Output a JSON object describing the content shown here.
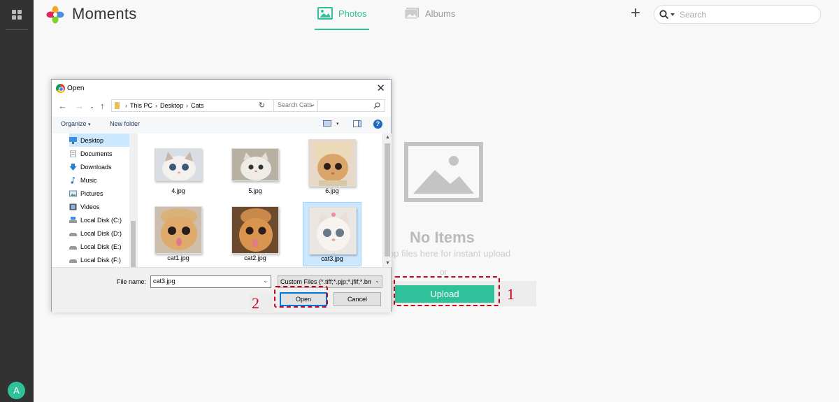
{
  "app": {
    "title": "Moments",
    "user_initial": "A"
  },
  "header": {
    "tabs": [
      {
        "label": "Photos",
        "active": true
      },
      {
        "label": "Albums",
        "active": false
      }
    ],
    "search_placeholder": "Search"
  },
  "empty_state": {
    "heading": "No Items",
    "hint": "op files here for instant upload",
    "or": "or",
    "upload_label": "Upload"
  },
  "callouts": {
    "step1": "1",
    "step2": "2"
  },
  "dialog": {
    "title": "Open",
    "breadcrumb": [
      "This PC",
      "Desktop",
      "Cats"
    ],
    "search_placeholder": "Search Cats",
    "organize_label": "Organize",
    "new_folder_label": "New folder",
    "nav_items": [
      {
        "label": "Desktop",
        "icon": "desktop-icon",
        "selected": true
      },
      {
        "label": "Documents",
        "icon": "documents-icon"
      },
      {
        "label": "Downloads",
        "icon": "downloads-icon"
      },
      {
        "label": "Music",
        "icon": "music-icon"
      },
      {
        "label": "Pictures",
        "icon": "pictures-icon"
      },
      {
        "label": "Videos",
        "icon": "videos-icon"
      },
      {
        "label": "Local Disk (C:)",
        "icon": "disk-icon"
      },
      {
        "label": "Local Disk (D:)",
        "icon": "disk-icon"
      },
      {
        "label": "Local Disk (E:)",
        "icon": "disk-icon"
      },
      {
        "label": "Local Disk (F:)",
        "icon": "disk-icon"
      }
    ],
    "files": [
      {
        "name": "4.jpg"
      },
      {
        "name": "5.jpg"
      },
      {
        "name": "6.jpg"
      },
      {
        "name": "cat1.jpg"
      },
      {
        "name": "cat2.jpg"
      },
      {
        "name": "cat3.jpg",
        "selected": true
      }
    ],
    "file_name_label": "File name:",
    "file_name_value": "cat3.jpg",
    "file_type": "Custom Files (*.tiff;*.pjp;*.jfif;*.bmp",
    "open_label": "Open",
    "cancel_label": "Cancel"
  },
  "colors": {
    "accent": "#2fc29a",
    "callout": "#d0021b",
    "sidebar": "#323232"
  }
}
